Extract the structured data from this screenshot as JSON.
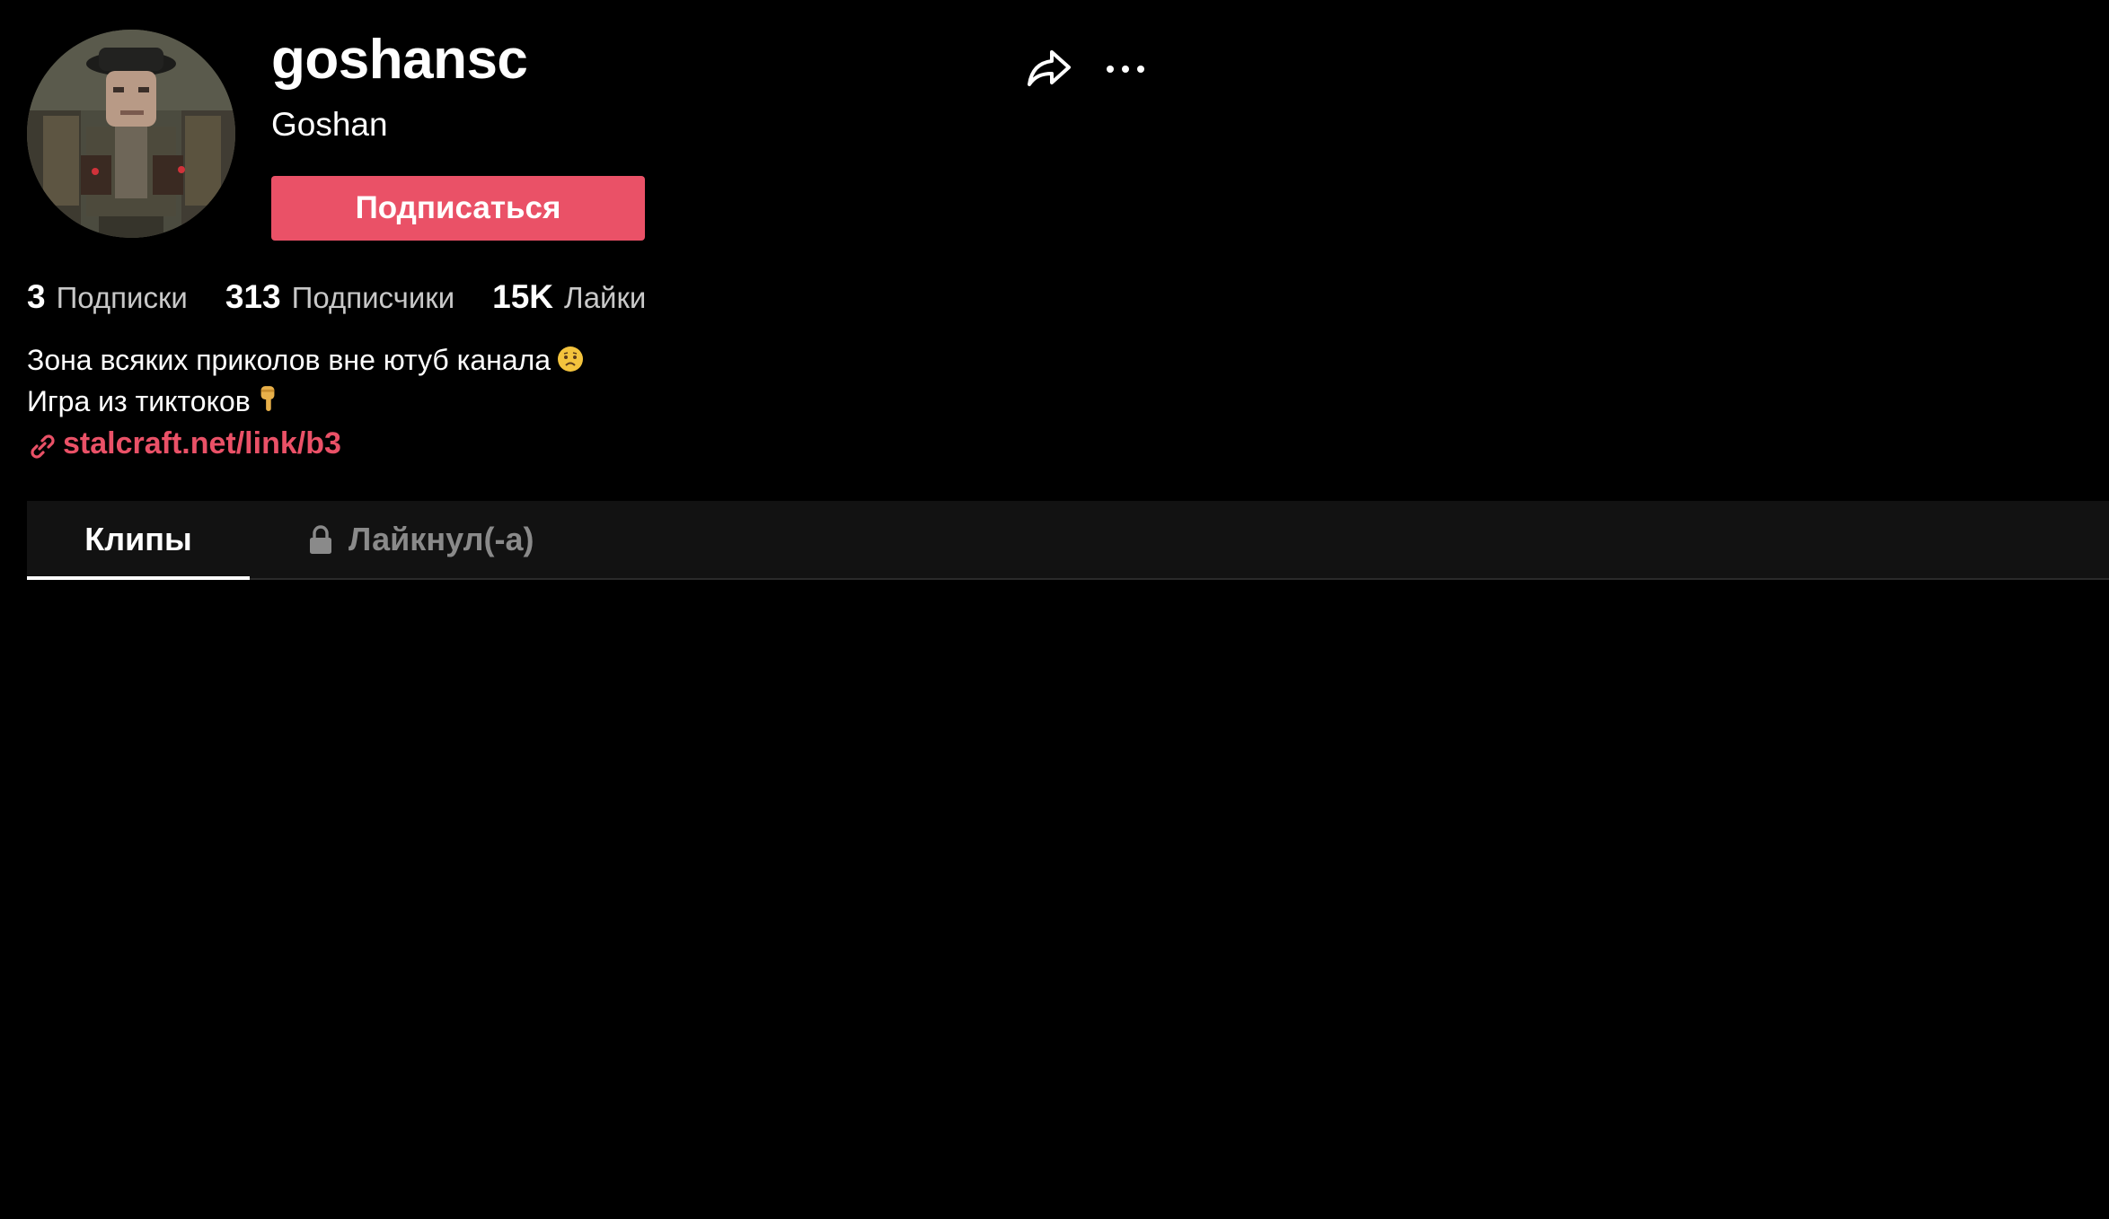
{
  "profile": {
    "username": "goshansc",
    "nickname": "Goshan",
    "follow_label": "Подписаться",
    "avatar_icon": "profile-avatar"
  },
  "actions": {
    "share_icon": "share-icon",
    "more_icon": "more-icon"
  },
  "stats": {
    "following_count": "3",
    "following_label": "Подписки",
    "followers_count": "313",
    "followers_label": "Подписчики",
    "likes_count": "15K",
    "likes_label": "Лайки"
  },
  "bio": {
    "line1": "Зона всяких приколов вне ютуб канала",
    "line1_emoji": "worried-face-emoji",
    "line2": "Игра из тиктоков",
    "line2_emoji": "pointing-down-emoji"
  },
  "link": {
    "icon": "link-icon",
    "text": "stalcraft.net/link/b3"
  },
  "tabs": [
    {
      "label": "Клипы",
      "active": true
    },
    {
      "label": "Лайкнул(-а)",
      "active": false,
      "icon": "lock-icon"
    }
  ],
  "colors": {
    "background": "#000000",
    "accent": "#ea5167",
    "tabs_background": "#121212",
    "muted_text": "#c8c8c8",
    "inactive_tab": "#8a8a8a"
  }
}
